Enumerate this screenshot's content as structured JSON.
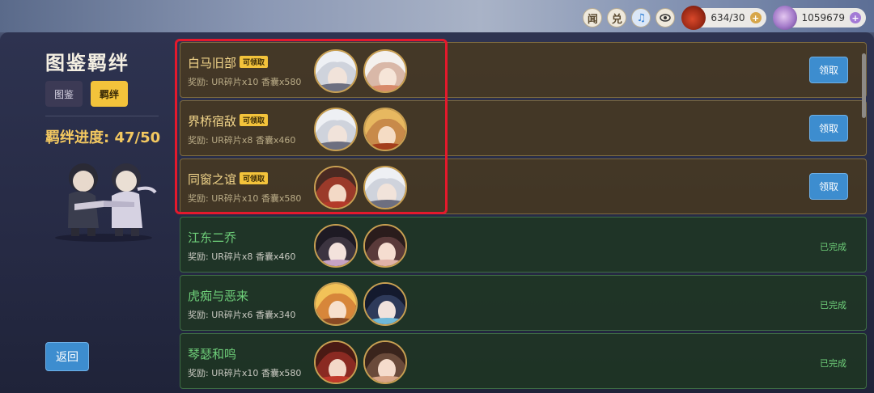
{
  "topbar": {
    "btn_news": "闻",
    "btn_redeem": "兑",
    "btn_music": "♫",
    "btn_view": "👁",
    "stamina": "634/30",
    "currency": "1059679"
  },
  "sidebar": {
    "title": "图鉴羁绊",
    "tabs": [
      {
        "label": "图鉴",
        "active": false
      },
      {
        "label": "羁绊",
        "active": true
      }
    ],
    "progress_text": "羁绊进度: 47/50",
    "back_label": "返回"
  },
  "bonds": [
    {
      "name": "白马旧部",
      "badge": "可领取",
      "reward": "奖励: UR碎片x10  香囊x580",
      "status": "claimable",
      "action": "领取"
    },
    {
      "name": "界桥宿敌",
      "badge": "可领取",
      "reward": "奖励: UR碎片x8  香囊x460",
      "status": "claimable",
      "action": "领取"
    },
    {
      "name": "同窗之谊",
      "badge": "可领取",
      "reward": "奖励: UR碎片x10  香囊x580",
      "status": "claimable",
      "action": "领取"
    },
    {
      "name": "江东二乔",
      "badge": "",
      "reward": "奖励: UR碎片x8  香囊x460",
      "status": "done",
      "action": "已完成"
    },
    {
      "name": "虎痴与恶来",
      "badge": "",
      "reward": "奖励: UR碎片x6  香囊x340",
      "status": "done",
      "action": "已完成"
    },
    {
      "name": "琴瑟和鸣",
      "badge": "",
      "reward": "奖励: UR碎片x10  香囊x580",
      "status": "done",
      "action": "已完成"
    }
  ],
  "colors": {
    "accent_gold": "#f3c33b",
    "button_blue": "#3d8dcf",
    "done_green": "#6fd07a",
    "highlight_red": "#e5192c"
  }
}
